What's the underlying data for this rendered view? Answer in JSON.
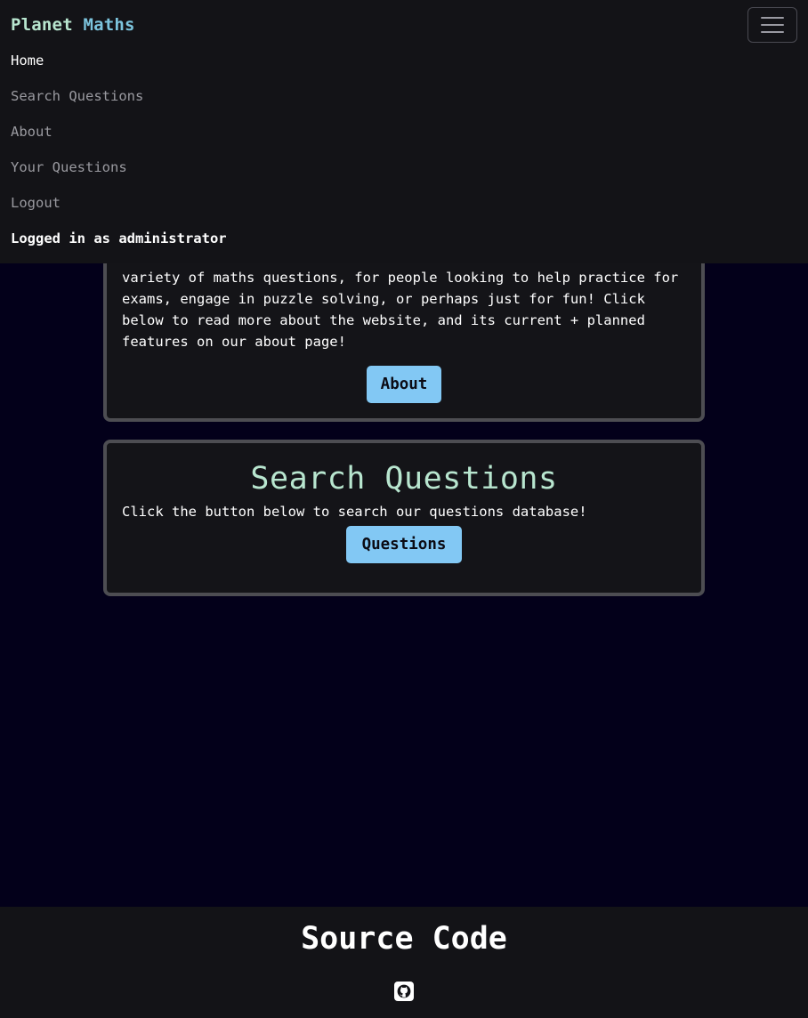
{
  "navbar": {
    "brand_part1": "Planet",
    "brand_part2": "Maths",
    "toggler_icon": "hamburger-menu-icon",
    "items": [
      {
        "label": "Home",
        "active": true
      },
      {
        "label": "Search Questions",
        "active": false
      },
      {
        "label": "About",
        "active": false
      },
      {
        "label": "Your Questions",
        "active": false
      },
      {
        "label": "Logout",
        "active": false
      }
    ],
    "user_status": "Logged in as administrator"
  },
  "intro_card": {
    "text": "variety of maths questions, for people looking to help practice for exams, engage in puzzle solving, or perhaps just for fun! Click below to read more about the website, and its current + planned features on our about page!",
    "button_label": "About"
  },
  "search_card": {
    "title": "Search Questions",
    "text": "Click the button below to search our questions database!",
    "button_label": "Questions"
  },
  "footer": {
    "title": "Source Code",
    "icon": "github-icon"
  },
  "colors": {
    "background": "#03001a",
    "panel": "#131317",
    "accent_green": "#b8e6cf",
    "accent_blue": "#7cc4dd",
    "button": "#82c8f4",
    "card_border": "#4d4d52"
  }
}
